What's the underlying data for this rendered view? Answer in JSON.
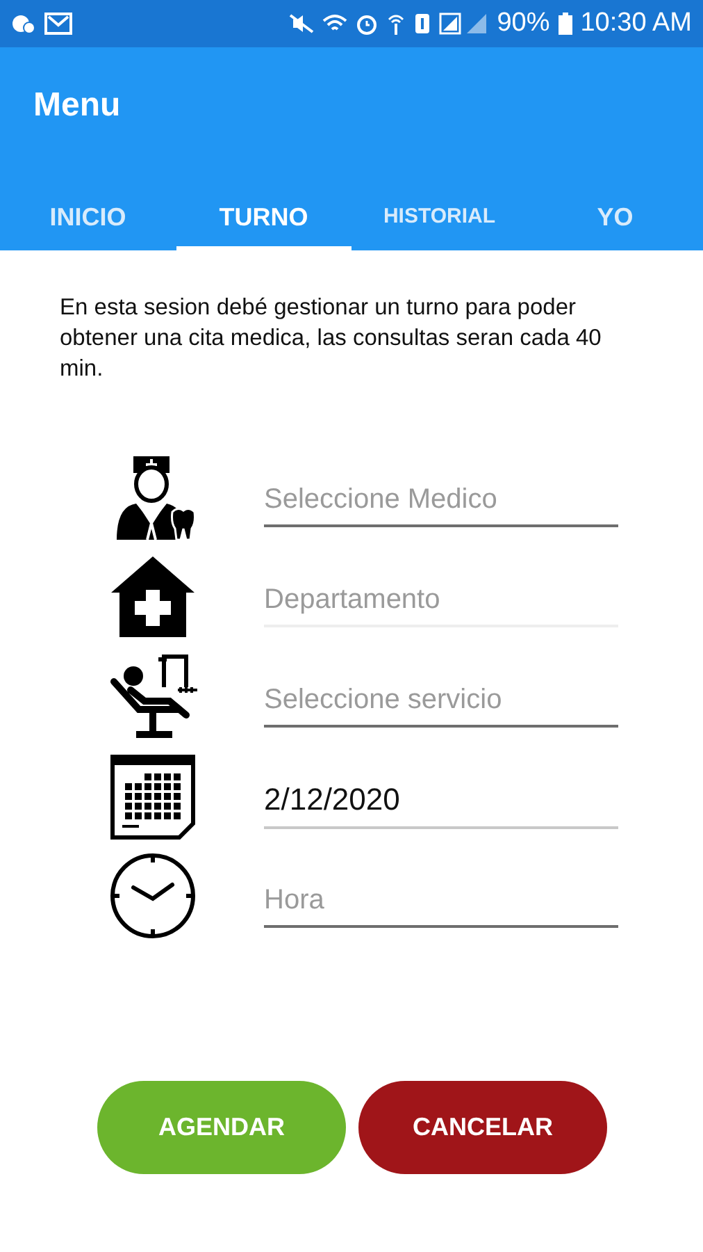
{
  "status_bar": {
    "battery": "90%",
    "time": "10:30 AM"
  },
  "app_bar": {
    "title": "Menu"
  },
  "tabs": [
    {
      "label": "INICIO",
      "selected": false
    },
    {
      "label": "TURNO",
      "selected": true
    },
    {
      "label": "HISTORIAL",
      "selected": false
    },
    {
      "label": "YO",
      "selected": false
    }
  ],
  "intro": "En esta sesion debé gestionar un turno para poder obtener una cita medica, las consultas seran cada 40 min.",
  "fields": [
    {
      "kind": "doctor",
      "placeholder": "Seleccione Medico",
      "disabled": false
    },
    {
      "kind": "hospital",
      "placeholder": "Departamento",
      "disabled": true
    },
    {
      "kind": "chair",
      "placeholder": "Seleccione servicio",
      "disabled": false
    },
    {
      "kind": "calendar",
      "value": "2/12/2020",
      "disabled": false
    },
    {
      "kind": "clock",
      "placeholder": "Hora",
      "disabled": false
    }
  ],
  "buttons": [
    {
      "label": "AGENDAR",
      "kind": "primary"
    },
    {
      "label": "CANCELAR",
      "kind": "danger"
    }
  ]
}
